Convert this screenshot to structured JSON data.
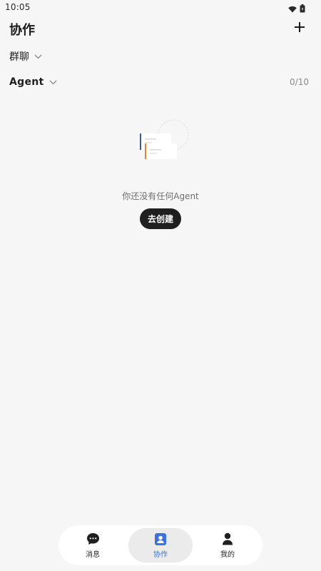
{
  "status_bar": {
    "time": "10:05",
    "icons": [
      "wifi-icon",
      "battery-icon"
    ]
  },
  "header": {
    "title": "协作",
    "add_icon": "plus-icon"
  },
  "sections": {
    "group_chat": {
      "label": "群聊",
      "icon": "chevron-down-icon"
    },
    "agent": {
      "label": "Agent",
      "icon": "chevron-down-icon",
      "count": "0/10"
    }
  },
  "empty_state": {
    "message": "你还没有任何Agent",
    "button_label": "去创建",
    "illustration": "empty-cards-illustration"
  },
  "bottom_nav": {
    "items": [
      {
        "label": "消息",
        "icon": "chat-bubble-icon",
        "active": false
      },
      {
        "label": "协作",
        "icon": "contact-card-icon",
        "active": true
      },
      {
        "label": "我的",
        "icon": "person-icon",
        "active": false
      }
    ]
  },
  "colors": {
    "background": "#f6f6f6",
    "accent": "#3d6fe5",
    "button_dark": "#1f1f1f",
    "nav_active_bg": "#ebebeb"
  }
}
